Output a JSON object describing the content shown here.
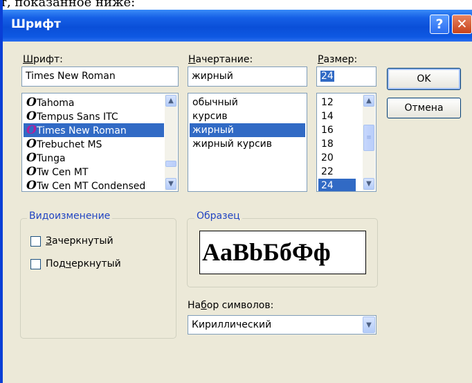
{
  "doc_text": "т, показанное ниже:",
  "window": {
    "title": "Шрифт",
    "help_label": "?",
    "close_label": "✕"
  },
  "font": {
    "label_pre": "",
    "label_key": "Ш",
    "label_post": "рифт:",
    "value": "Times New Roman",
    "list": [
      {
        "name": "Tahoma",
        "selected": false
      },
      {
        "name": "Tempus Sans ITC",
        "selected": false
      },
      {
        "name": "Times New Roman",
        "selected": true
      },
      {
        "name": "Trebuchet MS",
        "selected": false
      },
      {
        "name": "Tunga",
        "selected": false
      },
      {
        "name": "Tw Cen MT",
        "selected": false
      },
      {
        "name": "Tw Cen MT Condensed",
        "selected": false
      }
    ],
    "icon_glyph": "O"
  },
  "style": {
    "label_pre": "",
    "label_key": "Н",
    "label_post": "ачертание:",
    "value": "жирный",
    "list": [
      {
        "name": "обычный",
        "selected": false
      },
      {
        "name": "курсив",
        "selected": false
      },
      {
        "name": "жирный",
        "selected": true
      },
      {
        "name": "жирный курсив",
        "selected": false
      }
    ]
  },
  "size": {
    "label_pre": "",
    "label_key": "Р",
    "label_post": "азмер:",
    "value": "24",
    "list": [
      {
        "name": "12",
        "selected": false
      },
      {
        "name": "14",
        "selected": false
      },
      {
        "name": "16",
        "selected": false
      },
      {
        "name": "18",
        "selected": false
      },
      {
        "name": "20",
        "selected": false
      },
      {
        "name": "22",
        "selected": false
      },
      {
        "name": "24",
        "selected": true
      }
    ]
  },
  "buttons": {
    "ok": "OK",
    "cancel": "Отмена"
  },
  "effects": {
    "title": "Видоизменение",
    "strikeout": {
      "pre": "",
      "key": "З",
      "post": "ачеркнутый",
      "checked": false
    },
    "underline": {
      "pre": "Под",
      "key": "ч",
      "post": "еркнутый",
      "checked": false
    }
  },
  "sample": {
    "title": "Образец",
    "text": "AaBbБбФф"
  },
  "charset": {
    "label_pre": "На",
    "label_key": "б",
    "label_post": "ор символов:",
    "value": "Кириллический"
  },
  "colors": {
    "titlebar": "#0a4fd8",
    "selection": "#316ac5",
    "group_title": "#2144c2",
    "dialog_bg": "#ece9d8"
  }
}
